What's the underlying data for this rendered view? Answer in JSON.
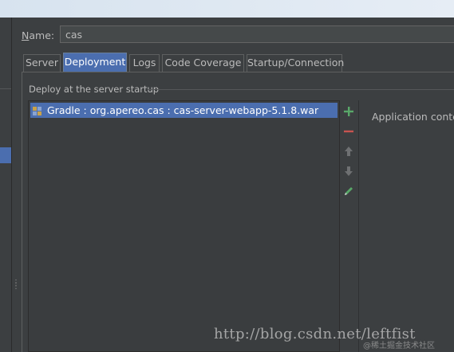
{
  "dialog": {
    "name_label": "Name:",
    "name_value": "cas"
  },
  "tabs": [
    {
      "label": "Server"
    },
    {
      "label": "Deployment"
    },
    {
      "label": "Logs"
    },
    {
      "label": "Code Coverage"
    },
    {
      "label": "Startup/Connection"
    }
  ],
  "active_tab": "Deployment",
  "deployment": {
    "section_label": "Deploy at the server startup",
    "items": [
      {
        "label": "Gradle : org.apereo.cas : cas-server-webapp-5.1.8.war",
        "icon": "gradle-artifact-icon"
      }
    ],
    "toolbar": {
      "add_icon": "plus-icon",
      "remove_icon": "minus-icon",
      "up_icon": "arrow-up-icon",
      "down_icon": "arrow-down-icon",
      "edit_icon": "pencil-icon"
    },
    "app_context_label": "Application contex"
  },
  "watermark": {
    "url": "http://blog.csdn.net/leftfist",
    "credit": "@稀土掘金技术社区"
  },
  "colors": {
    "background": "#3c3f41",
    "selection": "#4b6eaf",
    "add_green": "#59a869",
    "remove_red": "#c75450"
  }
}
